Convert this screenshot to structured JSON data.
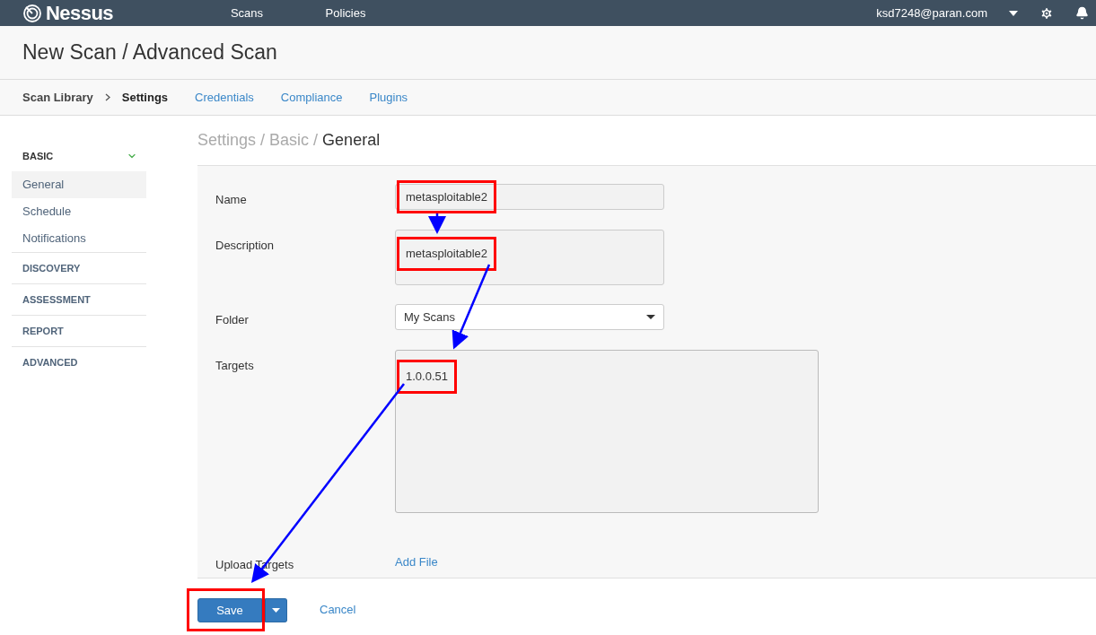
{
  "topbar": {
    "brand": "Nessus",
    "nav": [
      {
        "label": "Scans"
      },
      {
        "label": "Policies"
      }
    ],
    "user": "ksd7248@paran.com"
  },
  "page_title": "New Scan / Advanced Scan",
  "tabs": [
    {
      "label": "Scan Library",
      "kind": "crumb",
      "selected": false
    },
    {
      "label": "Settings",
      "kind": "crumb",
      "selected": true
    },
    {
      "label": "Credentials",
      "kind": "link",
      "selected": false
    },
    {
      "label": "Compliance",
      "kind": "link",
      "selected": false
    },
    {
      "label": "Plugins",
      "kind": "link",
      "selected": false
    }
  ],
  "sidebar": {
    "sections": [
      {
        "label": "BASIC",
        "expanded": true,
        "items": [
          {
            "label": "General",
            "selected": true
          },
          {
            "label": "Schedule",
            "selected": false
          },
          {
            "label": "Notifications",
            "selected": false
          }
        ]
      },
      {
        "label": "DISCOVERY",
        "expanded": false
      },
      {
        "label": "ASSESSMENT",
        "expanded": false
      },
      {
        "label": "REPORT",
        "expanded": false
      },
      {
        "label": "ADVANCED",
        "expanded": false
      }
    ]
  },
  "breadcrumb": [
    "Settings /",
    "Basic /",
    "General"
  ],
  "form": [
    {
      "label": "Name",
      "kind": "text",
      "value": "metasploitable2",
      "highlighted": true
    },
    {
      "label": "Description",
      "kind": "textarea",
      "value": "metasploitable2",
      "highlighted": true
    },
    {
      "label": "Folder",
      "kind": "select",
      "value": "My Scans"
    },
    {
      "label": "Targets",
      "kind": "bigtextarea",
      "value": "1.0.0.51",
      "highlighted": true
    },
    {
      "label": "Upload Targets",
      "kind": "link",
      "value": "Add File"
    }
  ],
  "actions": {
    "save": "Save",
    "save_highlighted": true,
    "cancel": "Cancel"
  }
}
